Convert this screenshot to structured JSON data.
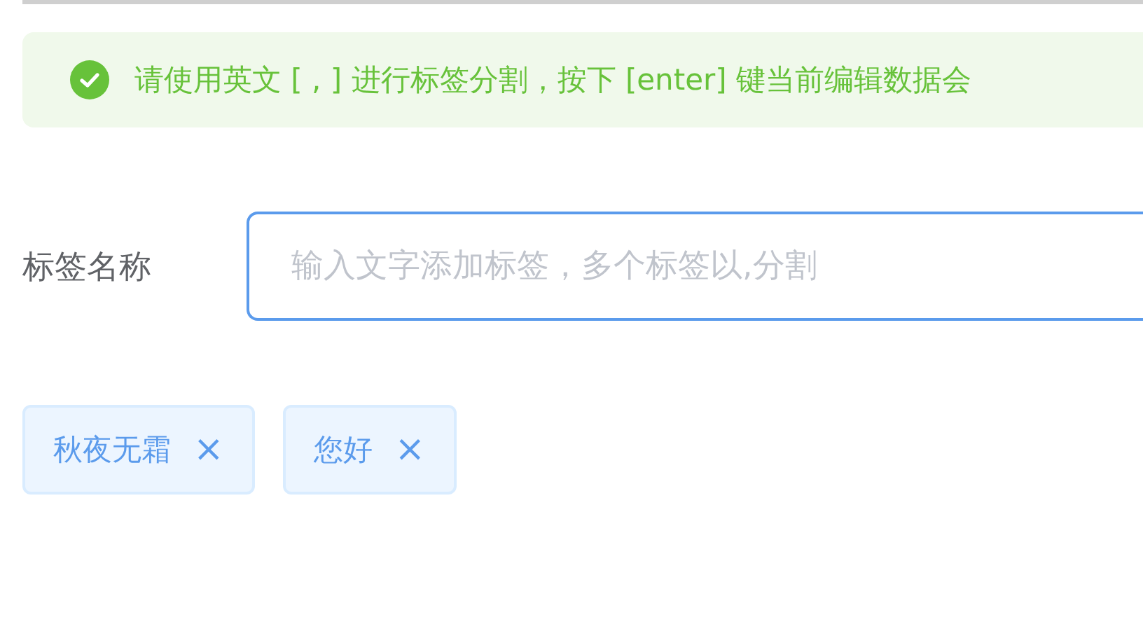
{
  "alert": {
    "success": true,
    "text": "请使用英文 [ , ] 进行标签分割，按下 [enter] 键当前编辑数据会"
  },
  "field": {
    "label": "标签名称",
    "placeholder": "输入文字添加标签，多个标签以,分割",
    "focused": true
  },
  "tags": [
    {
      "label": "秋夜无霜",
      "close": "×"
    },
    {
      "label": "您好",
      "close": "×"
    }
  ]
}
